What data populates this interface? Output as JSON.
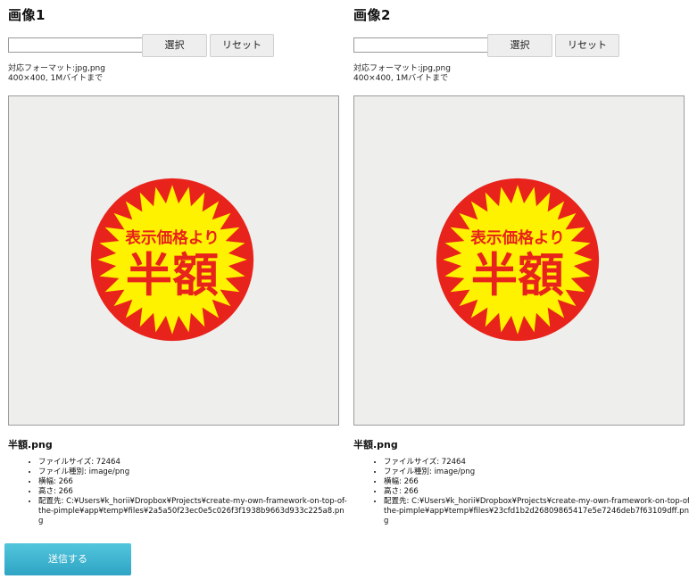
{
  "panels": [
    {
      "title": "画像1",
      "file_value": "",
      "select_label": "選択",
      "reset_label": "リセット",
      "format_line1": "対応フォーマット:jpg,png",
      "format_line2": "400×400, 1Mバイトまで",
      "sticker_top_text": "表示価格より",
      "sticker_main_text": "半額",
      "file_name": "半額.png",
      "info": [
        "ファイルサイズ: 72464",
        "ファイル種別: image/png",
        "横幅: 266",
        "高さ: 266",
        "配置先: C:¥Users¥k_horii¥Dropbox¥Projects¥create-my-own-framework-on-top-of-the-pimple¥app¥temp¥files¥2a5a50f23ec0e5c026f3f1938b9663d933c225a8.png"
      ]
    },
    {
      "title": "画像2",
      "file_value": "",
      "select_label": "選択",
      "reset_label": "リセット",
      "format_line1": "対応フォーマット:jpg,png",
      "format_line2": "400×400, 1Mバイトまで",
      "sticker_top_text": "表示価格より",
      "sticker_main_text": "半額",
      "file_name": "半額.png",
      "info": [
        "ファイルサイズ: 72464",
        "ファイル種別: image/png",
        "横幅: 266",
        "高さ: 266",
        "配置先: C:¥Users¥k_horii¥Dropbox¥Projects¥create-my-own-framework-on-top-of-the-pimple¥app¥temp¥files¥23cfd1b2d26809865417e5e7246deb7f63109dff.png"
      ]
    }
  ],
  "submit_label": "送信する",
  "colors": {
    "sticker_red": "#e8231b",
    "sticker_yellow": "#fff200",
    "submit_top": "#52c6dc",
    "submit_bottom": "#2fa4c4",
    "preview_bg": "#eeeeed"
  }
}
